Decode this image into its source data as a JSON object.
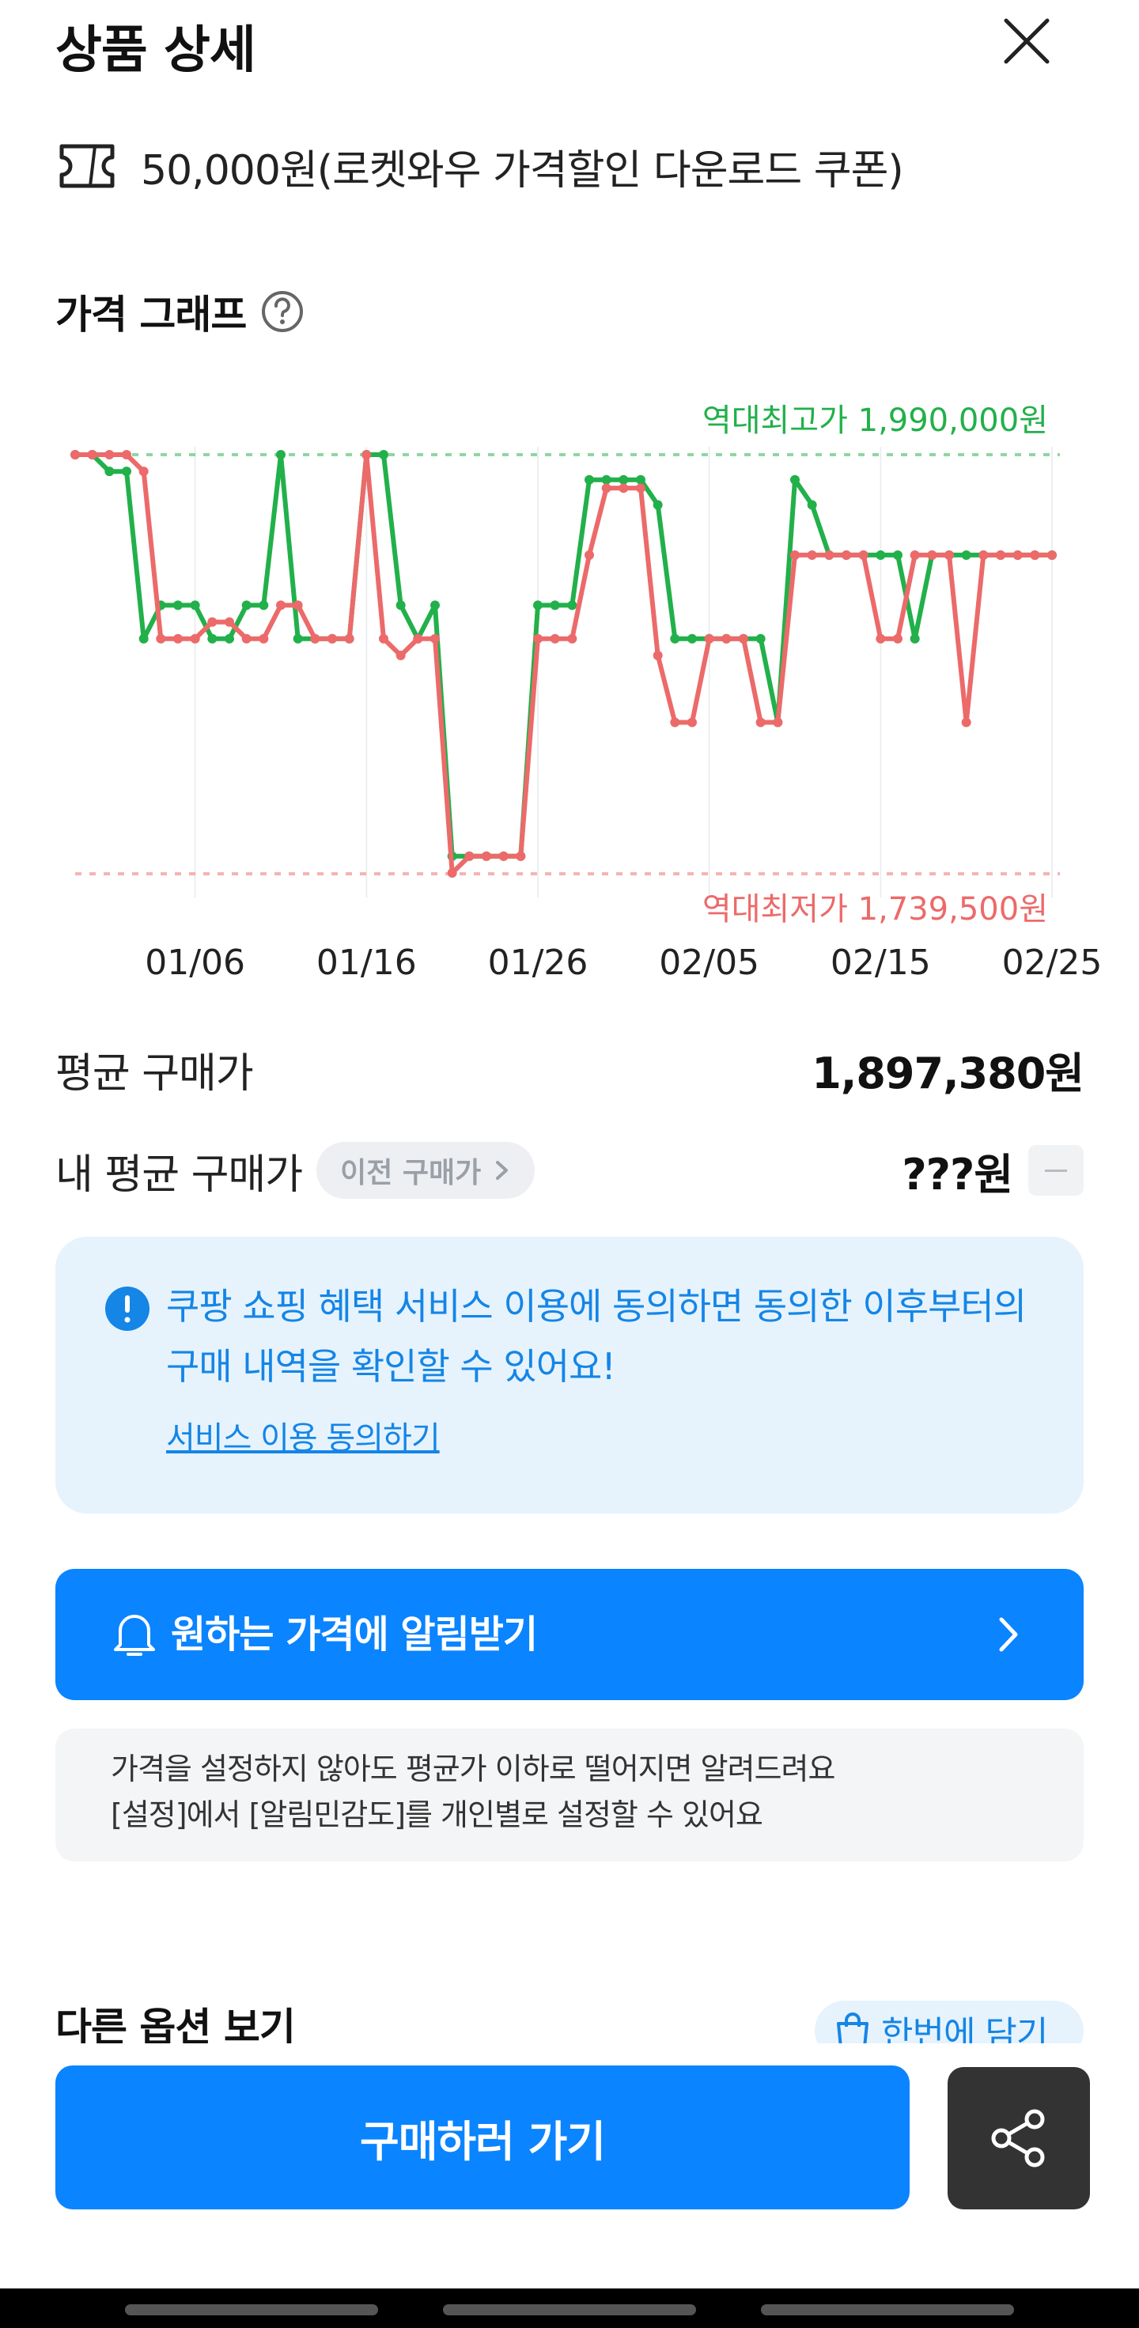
{
  "header": {
    "title": "상품 상세"
  },
  "coupon": {
    "icon": "ticket-icon",
    "text": "50,000원(로켓와우 가격할인 다운로드 쿠폰)"
  },
  "graph": {
    "title": "가격 그래프",
    "help_icon": "question-circle-icon"
  },
  "chart_data": {
    "type": "line",
    "x": [
      "12/30",
      "12/31",
      "01/01",
      "01/02",
      "01/03",
      "01/04",
      "01/05",
      "01/06",
      "01/07",
      "01/08",
      "01/09",
      "01/10",
      "01/11",
      "01/12",
      "01/13",
      "01/14",
      "01/15",
      "01/16",
      "01/17",
      "01/18",
      "01/19",
      "01/20",
      "01/21",
      "01/22",
      "01/23",
      "01/24",
      "01/25",
      "01/26",
      "01/27",
      "01/28",
      "01/29",
      "01/30",
      "01/31",
      "02/01",
      "02/02",
      "02/03",
      "02/04",
      "02/05",
      "02/06",
      "02/07",
      "02/08",
      "02/09",
      "02/10",
      "02/11",
      "02/12",
      "02/13",
      "02/14",
      "02/15",
      "02/16",
      "02/17",
      "02/18",
      "02/19",
      "02/20",
      "02/21",
      "02/22",
      "02/23",
      "02/24",
      "02/25"
    ],
    "x_ticks": [
      "01/06",
      "01/16",
      "01/26",
      "02/05",
      "02/15",
      "02/25"
    ],
    "series": [
      {
        "color": "#22b04a",
        "values": [
          1990000,
          1990000,
          1980000,
          1980000,
          1880000,
          1900000,
          1900000,
          1900000,
          1880000,
          1880000,
          1900000,
          1900000,
          1990000,
          1880000,
          1880000,
          1880000,
          1880000,
          1990000,
          1990000,
          1900000,
          1880000,
          1900000,
          1750000,
          1750000,
          1750000,
          1750000,
          1750000,
          1900000,
          1900000,
          1900000,
          1975000,
          1975000,
          1975000,
          1975000,
          1960000,
          1880000,
          1880000,
          1880000,
          1880000,
          1880000,
          1880000,
          1830000,
          1975000,
          1960000,
          1930000,
          1930000,
          1930000,
          1930000,
          1930000,
          1880000,
          1930000,
          1930000,
          1930000,
          1930000,
          1930000,
          1930000,
          1930000,
          1930000
        ]
      },
      {
        "color": "#ec6a6a",
        "values": [
          1990000,
          1990000,
          1990000,
          1990000,
          1980000,
          1880000,
          1880000,
          1880000,
          1890000,
          1890000,
          1880000,
          1880000,
          1900000,
          1900000,
          1880000,
          1880000,
          1880000,
          1990000,
          1880000,
          1870000,
          1880000,
          1880000,
          1740000,
          1750000,
          1750000,
          1750000,
          1750000,
          1880000,
          1880000,
          1880000,
          1930000,
          1970000,
          1970000,
          1970000,
          1870000,
          1830000,
          1830000,
          1880000,
          1880000,
          1880000,
          1830000,
          1830000,
          1930000,
          1930000,
          1930000,
          1930000,
          1930000,
          1880000,
          1880000,
          1930000,
          1930000,
          1930000,
          1830000,
          1930000,
          1930000,
          1930000,
          1930000,
          1930000
        ]
      }
    ],
    "ylim": [
      1739500,
      1990000
    ],
    "annotations": {
      "max_label": "역대최고가 1,990,000원",
      "min_label": "역대최저가 1,739,500원"
    },
    "grid": true
  },
  "stats": {
    "avg_label": "평균 구매가",
    "avg_value": "1,897,380원",
    "my_avg_label": "내 평균 구매가",
    "prev_purchase_label": "이전 구매가",
    "my_avg_value": "???원"
  },
  "info": {
    "text": "쿠팡 쇼핑 혜택 서비스 이용에 동의하면 동의한 이후부터의 구매 내역을 확인할 수 있어요!",
    "link": "서비스 이용 동의하기"
  },
  "alert": {
    "label": "원하는 가격에 알림받기"
  },
  "note": {
    "line1": "가격을 설정하지 않아도 평균가 이하로 떨어지면 알려드려요",
    "line2": "[설정]에서 [알림민감도]를 개인별로 설정할 수 있어요"
  },
  "other_options": {
    "title": "다른 옵션 보기",
    "cart_label": "한번에 담기"
  },
  "bottom": {
    "buy_label": "구매하러 가기",
    "share_icon": "share-icon"
  },
  "colors": {
    "accent": "#0a84ff",
    "green": "#22b04a",
    "red": "#ec6a6a"
  }
}
